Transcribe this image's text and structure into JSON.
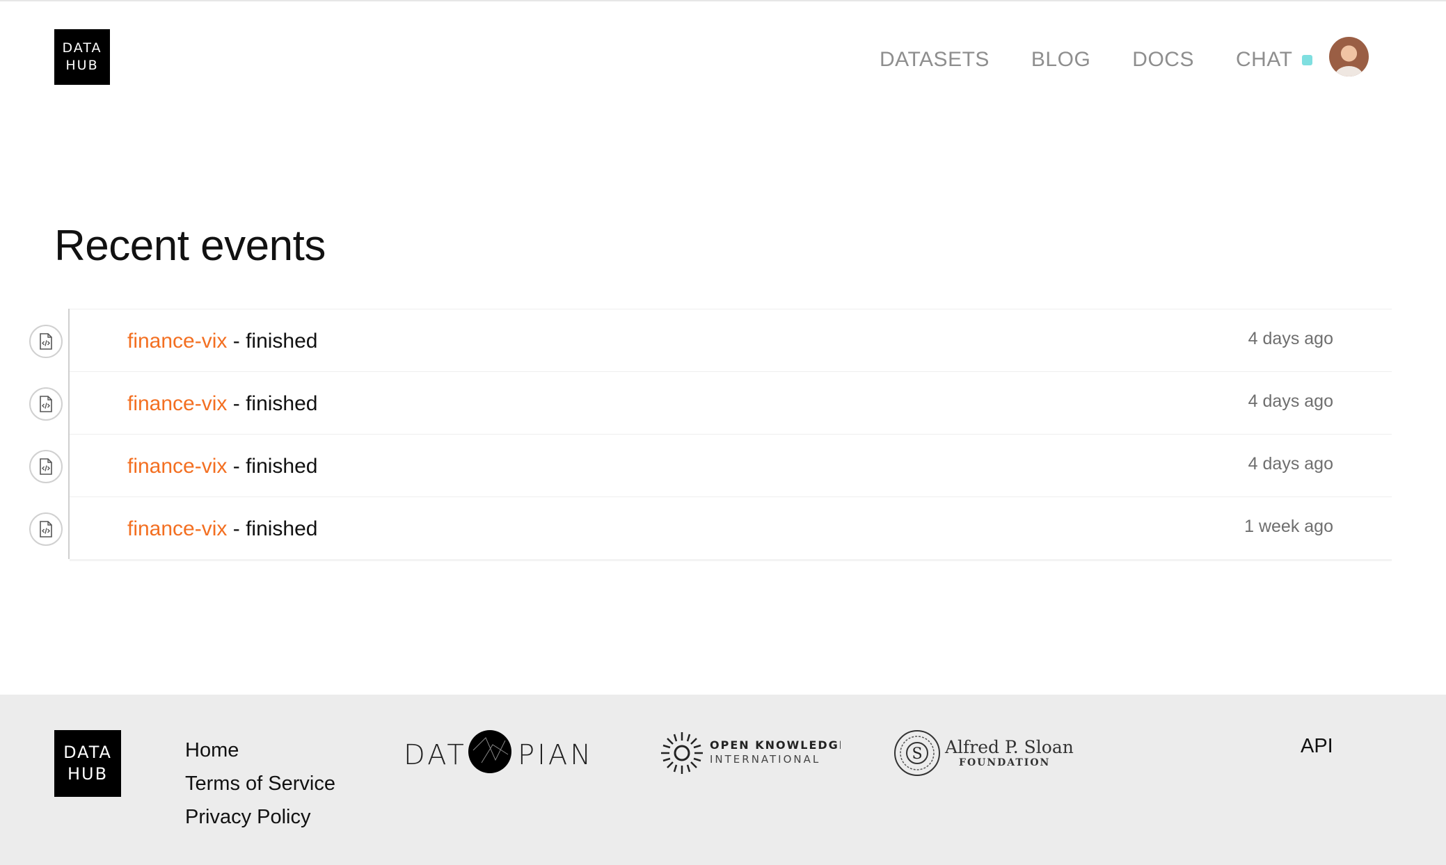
{
  "header": {
    "logo_line1": "DATA",
    "logo_line2": "HUB",
    "nav": {
      "datasets": "DATASETS",
      "blog": "BLOG",
      "docs": "DOCS",
      "chat": "CHAT"
    },
    "chat_status_color": "#7fdfe0"
  },
  "main": {
    "title": "Recent events",
    "events": [
      {
        "dataset": "finance-vix",
        "status": " - finished",
        "time": "4 days ago",
        "icon": "code-file-icon"
      },
      {
        "dataset": "finance-vix",
        "status": " - finished",
        "time": "4 days ago",
        "icon": "code-file-icon"
      },
      {
        "dataset": "finance-vix",
        "status": " - finished",
        "time": "4 days ago",
        "icon": "code-file-icon"
      },
      {
        "dataset": "finance-vix",
        "status": " - finished",
        "time": "1 week ago",
        "icon": "code-file-icon"
      }
    ],
    "link_color": "#f36f21"
  },
  "footer": {
    "logo_line1": "DATA",
    "logo_line2": "HUB",
    "links": [
      "Home",
      "Terms of Service",
      "Privacy Policy"
    ],
    "api": "API",
    "partners": {
      "datopian_left": "DAT",
      "datopian_right": "PIAN",
      "okfn_line1": "OPEN KNOWLEDGE",
      "okfn_line2": "INTERNATIONAL",
      "sloan_line1": "Alfred P. Sloan",
      "sloan_line2": "FOUNDATION"
    }
  }
}
